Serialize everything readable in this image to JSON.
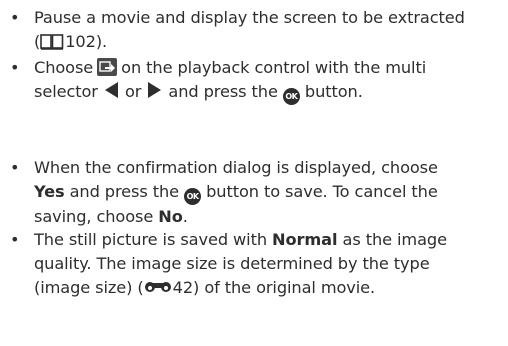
{
  "bullet": "•",
  "items": [
    {
      "line1": "Pause a movie and display the screen to be extracted",
      "line2_open": "(",
      "line2_page": "102).",
      "book_icon": "book-reference-icon"
    },
    {
      "line1_a": "Choose",
      "line1_b": "on the playback control with the multi",
      "line2_a": "selector",
      "line2_or": "or",
      "line2_b": "and press the",
      "line2_c": "button.",
      "extract_icon": "extract-still-icon",
      "left_icon": "left-arrow-icon",
      "right_icon": "right-arrow-icon",
      "ok_label": "OK"
    },
    {
      "line1": "When the confirmation dialog is displayed, choose",
      "line2_yes": "Yes",
      "line2_a": "and press the",
      "line2_b": "button to save. To cancel the",
      "line3_a": "saving, choose",
      "line3_no": "No",
      "line3_end": ".",
      "ok_label": "OK"
    },
    {
      "line1_a": "The still picture is saved with",
      "line1_normal": "Normal",
      "line1_b": "as the image",
      "line2": "quality. The image size is determined by the type",
      "line3_a": "(image size) (",
      "line3_b": "42) of the original movie.",
      "ref_icon": "reference-section-icon"
    }
  ]
}
